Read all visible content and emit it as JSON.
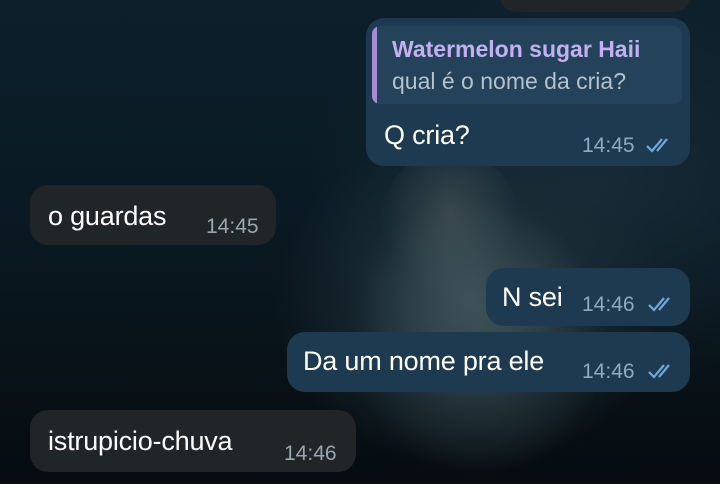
{
  "chat": {
    "messages": [
      {
        "direction": "outgoing",
        "reply": {
          "author": "Watermelon sugar Haii",
          "text": "qual é o nome da cria?"
        },
        "text": "Q cria?",
        "time": "14:45",
        "status": "read"
      },
      {
        "direction": "incoming",
        "text": "o guardas",
        "time": "14:45"
      },
      {
        "direction": "outgoing",
        "text": "N sei",
        "time": "14:46",
        "status": "read"
      },
      {
        "direction": "outgoing",
        "text": "Da um nome pra ele",
        "time": "14:46",
        "status": "read"
      },
      {
        "direction": "incoming",
        "text": "istrupicio-chuva",
        "time": "14:46"
      }
    ]
  },
  "colors": {
    "incoming_bubble": "#202527",
    "outgoing_bubble": "#1e3a50",
    "reply_accent": "#a58bd6",
    "read_check": "#6fa8dc"
  },
  "icons": {
    "read_status": "double-check-icon"
  }
}
